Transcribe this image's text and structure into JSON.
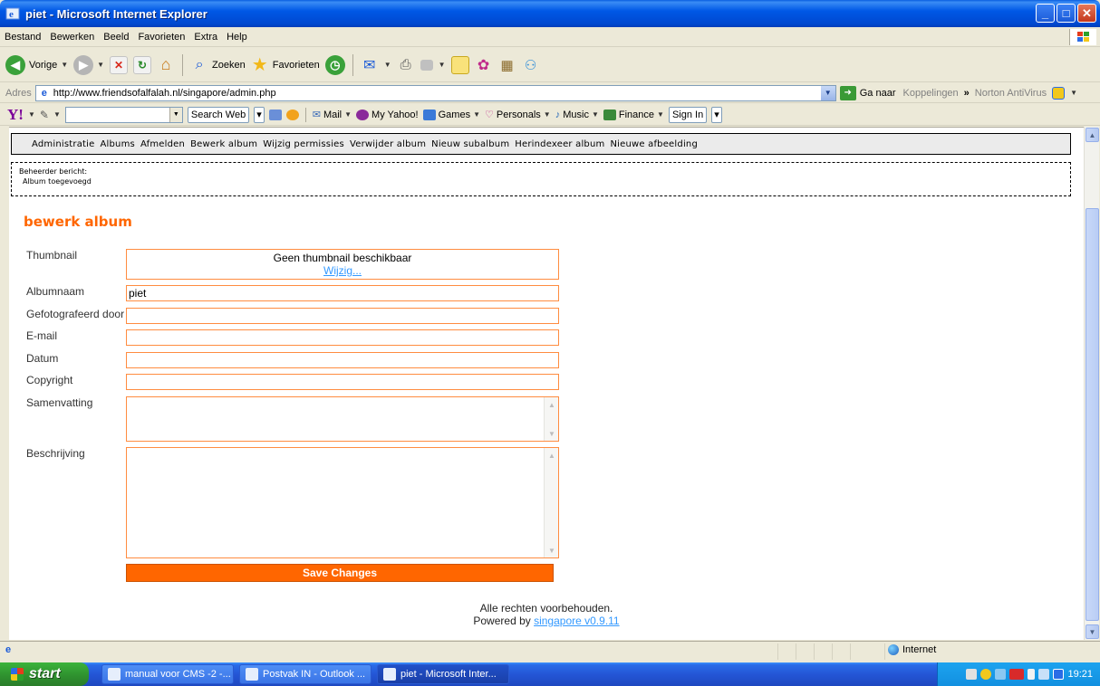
{
  "window": {
    "title": "piet - Microsoft Internet Explorer"
  },
  "menubar": {
    "items": [
      "Bestand",
      "Bewerken",
      "Beeld",
      "Favorieten",
      "Extra",
      "Help"
    ]
  },
  "toolbar": {
    "back_label": "Vorige",
    "search_label": "Zoeken",
    "favorites_label": "Favorieten"
  },
  "addressbar": {
    "label": "Adres",
    "url": "http://www.friendsofalfalah.nl/singapore/admin.php",
    "go_label": "Ga naar",
    "links_label": "Koppelingen",
    "chevron": "»",
    "norton_label": "Norton AntiVirus"
  },
  "yahoobar": {
    "search_button": "Search Web",
    "items": [
      "Mail",
      "My Yahoo!",
      "Games",
      "Personals",
      "Music",
      "Finance"
    ],
    "signin": "Sign In"
  },
  "admin": {
    "menu": [
      "Administratie",
      "Albums",
      "Afmelden",
      "Bewerk album",
      "Wijzig permissies",
      "Verwijder album",
      "Nieuw subalbum",
      "Herindexeer album",
      "Nieuwe afbeelding"
    ],
    "message_heading": "Beheerder bericht:",
    "message_text": "Album toegevoegd"
  },
  "page": {
    "heading": "bewerk album"
  },
  "form": {
    "thumbnail_label": "Thumbnail",
    "thumbnail_text": "Geen thumbnail beschikbaar",
    "thumbnail_link": "Wijzig...",
    "albumname_label": "Albumnaam",
    "albumname_value": "piet",
    "photographer_label": "Gefotografeerd door",
    "photographer_value": "",
    "email_label": "E-mail",
    "email_value": "",
    "date_label": "Datum",
    "date_value": "",
    "copyright_label": "Copyright",
    "copyright_value": "",
    "summary_label": "Samenvatting",
    "description_label": "Beschrijving",
    "save_label": "Save Changes"
  },
  "footer": {
    "rights": "Alle rechten voorbehouden.",
    "powered_prefix": "Powered by",
    "powered_link": "singapore v0.9.11"
  },
  "statusbar": {
    "zone": "Internet"
  },
  "taskbar": {
    "start_label": "start",
    "tasks": [
      "manual voor CMS -2 -...",
      "Postvak IN - Outlook ...",
      "piet - Microsoft Inter..."
    ],
    "clock": "19:21"
  },
  "colors": {
    "accent_orange": "#ff6600",
    "link_blue": "#3399ff"
  }
}
